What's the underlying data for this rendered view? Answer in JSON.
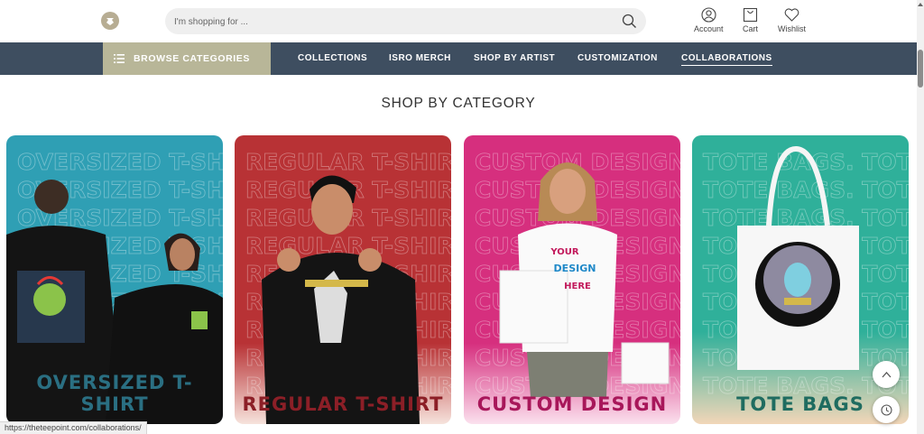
{
  "header": {
    "search_placeholder": "I'm shopping for ...",
    "account_label": "Account",
    "cart_label": "Cart",
    "wishlist_label": "Wishlist"
  },
  "navbar": {
    "browse_label": "BROWSE CATEGORIES",
    "items": [
      "COLLECTIONS",
      "ISRO MERCH",
      "SHOP BY ARTIST",
      "CUSTOMIZATION",
      "COLLABORATIONS"
    ],
    "active": "COLLABORATIONS"
  },
  "main": {
    "section_title": "SHOP BY CATEGORY",
    "cards": [
      {
        "label": "OVERSIZED T-SHIRT",
        "watermark": "OVERSIZED T-SHIRT",
        "bg": "#2f9fb4",
        "label_color": "#2a6f82"
      },
      {
        "label": "REGULAR T-SHIRT",
        "watermark": "REGULAR  T-SHIRT",
        "bg": "#b83235",
        "label_color": "#8c1f27"
      },
      {
        "label": "CUSTOM DESIGN",
        "watermark": "CUSTOM DESIGN",
        "bg": "#d62f7e",
        "label_color": "#a8175a"
      },
      {
        "label": "TOTE BAGS",
        "watermark": "TOTE BAGS. TOTE BAGS.",
        "bg": "#2fb09a",
        "label_color": "#1f6c60"
      }
    ],
    "mockup_text": [
      "YOUR",
      "DESIGN",
      "HERE"
    ]
  },
  "status_bar": {
    "url": "https://theteepoint.com/collaborations/"
  },
  "icons": [
    "search-icon",
    "account-icon",
    "cart-icon",
    "wishlist-icon",
    "menu-icon",
    "scroll-top-icon",
    "history-icon"
  ]
}
